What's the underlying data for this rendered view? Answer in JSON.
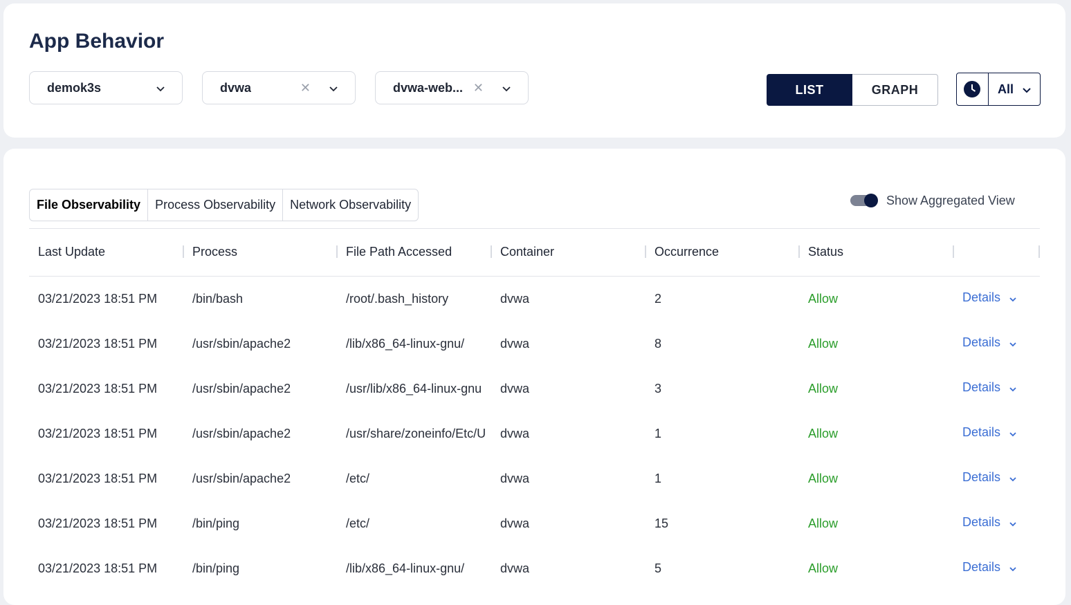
{
  "page": {
    "title": "App Behavior"
  },
  "filters": {
    "cluster": {
      "value": "demok3s"
    },
    "namespace": {
      "value": "dvwa",
      "clear_icon": "close-icon"
    },
    "workload": {
      "value": "dvwa-web...",
      "clear_icon": "close-icon"
    }
  },
  "view_toggle": {
    "list_label": "LIST",
    "graph_label": "GRAPH",
    "active": "LIST"
  },
  "time_range": {
    "icon": "clock-icon",
    "value": "All"
  },
  "tabs": [
    {
      "label": "File Observability",
      "active": true
    },
    {
      "label": "Process Observability",
      "active": false
    },
    {
      "label": "Network Observability",
      "active": false
    }
  ],
  "aggregated_toggle": {
    "label": "Show Aggregated View",
    "on": true
  },
  "table": {
    "columns": [
      "Last Update",
      "Process",
      "File Path Accessed",
      "Container",
      "Occurrence",
      "Status",
      ""
    ],
    "details_label": "Details",
    "rows": [
      {
        "last_update": "03/21/2023 18:51 PM",
        "process": "/bin/bash",
        "path": "/root/.bash_history",
        "container": "dvwa",
        "occurrence": "2",
        "status": "Allow"
      },
      {
        "last_update": "03/21/2023 18:51 PM",
        "process": "/usr/sbin/apache2",
        "path": "/lib/x86_64-linux-gnu/",
        "container": "dvwa",
        "occurrence": "8",
        "status": "Allow"
      },
      {
        "last_update": "03/21/2023 18:51 PM",
        "process": "/usr/sbin/apache2",
        "path": "/usr/lib/x86_64-linux-gnu",
        "container": "dvwa",
        "occurrence": "3",
        "status": "Allow"
      },
      {
        "last_update": "03/21/2023 18:51 PM",
        "process": "/usr/sbin/apache2",
        "path": "/usr/share/zoneinfo/Etc/U",
        "container": "dvwa",
        "occurrence": "1",
        "status": "Allow"
      },
      {
        "last_update": "03/21/2023 18:51 PM",
        "process": "/usr/sbin/apache2",
        "path": "/etc/",
        "container": "dvwa",
        "occurrence": "1",
        "status": "Allow"
      },
      {
        "last_update": "03/21/2023 18:51 PM",
        "process": "/bin/ping",
        "path": "/etc/",
        "container": "dvwa",
        "occurrence": "15",
        "status": "Allow"
      },
      {
        "last_update": "03/21/2023 18:51 PM",
        "process": "/bin/ping",
        "path": "/lib/x86_64-linux-gnu/",
        "container": "dvwa",
        "occurrence": "5",
        "status": "Allow"
      }
    ]
  },
  "colors": {
    "accent": "#0a1841",
    "status_allow": "#2a9d2a",
    "link": "#3b6ed4"
  }
}
